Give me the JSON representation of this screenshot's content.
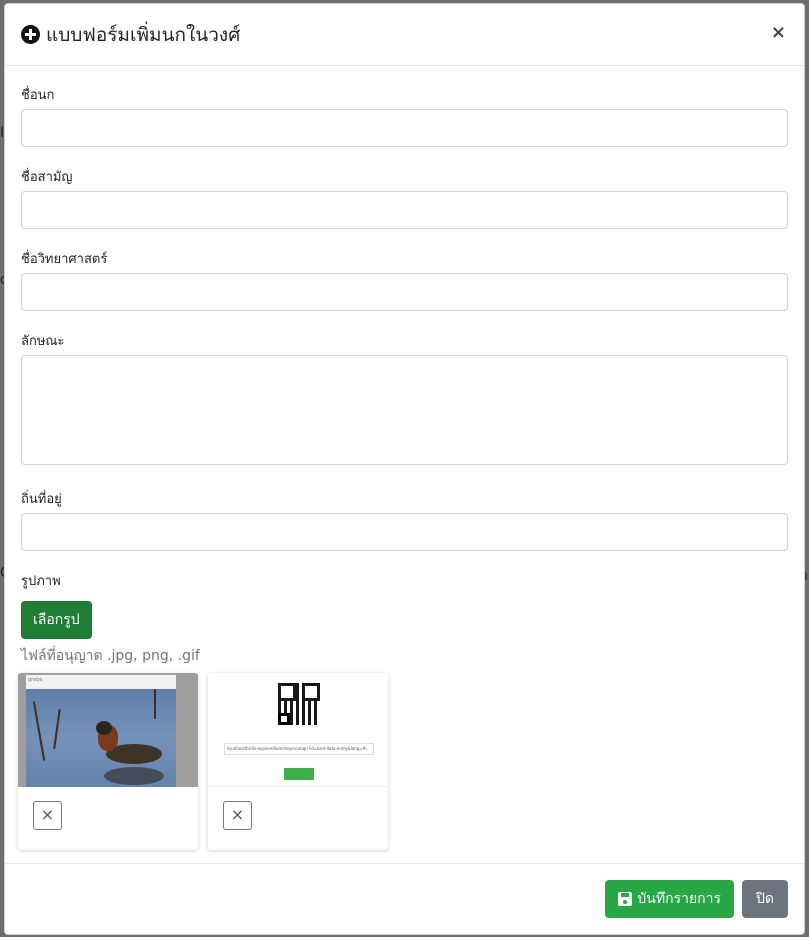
{
  "backdrop": {
    "fragments": [
      "I",
      "d",
      "C",
      "ว"
    ]
  },
  "modal": {
    "title": "แบบฟอร์มเพิ่มนกในวงศ์",
    "close_symbol": "×"
  },
  "form": {
    "fields": [
      {
        "label": "ชื่อนก",
        "value": ""
      },
      {
        "label": "ชื่อสามัญ",
        "value": ""
      },
      {
        "label": "ชื่อวิทยาศาสตร์",
        "value": ""
      },
      {
        "label": "ลักษณะ",
        "value": ""
      },
      {
        "label": "ถิ่นที่อยู่",
        "value": ""
      }
    ],
    "image_label": "รูปภาพ",
    "choose_button": "เลือกรูป",
    "allowed_hint": "ไฟล์ที่อนุญาต .jpg, png, .gif"
  },
  "thumbnails": [
    {
      "name": "bird-photo",
      "remove_symbol": "×",
      "caption": "grebe"
    },
    {
      "name": "qr-screenshot",
      "remove_symbol": "×",
      "url_text": "localhost/birds-explore/liamshop/scanqr/?id=bird-data-entry&lang=th"
    }
  ],
  "footer": {
    "save_label": "บันทึกรายการ",
    "close_label": "ปิด"
  },
  "colors": {
    "save": "#28a745",
    "choose": "#1e7e34",
    "close": "#6c757d"
  }
}
